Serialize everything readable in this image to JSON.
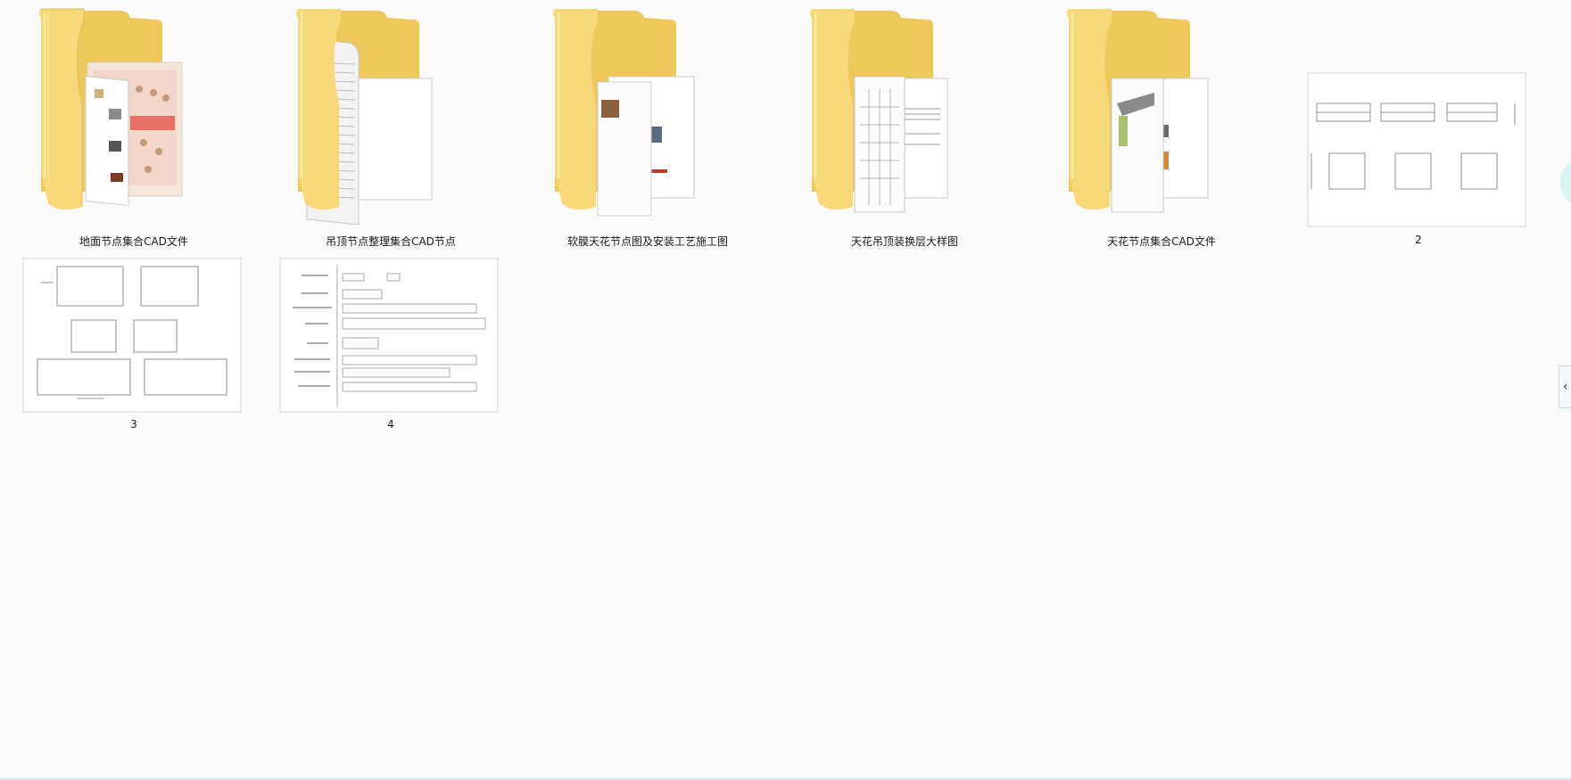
{
  "items": [
    {
      "name": "地面节点集合CAD文件",
      "type": "folder",
      "icon": "folder-icon"
    },
    {
      "name": "吊顶节点整理集合CAD节点",
      "type": "folder",
      "icon": "folder-icon"
    },
    {
      "name": "软膜天花节点图及安装工艺施工图",
      "type": "folder",
      "icon": "folder-icon"
    },
    {
      "name": "天花吊顶装换层大样图",
      "type": "folder",
      "icon": "folder-icon"
    },
    {
      "name": "天花节点集合CAD文件",
      "type": "folder",
      "icon": "folder-icon"
    },
    {
      "name": "2",
      "type": "image",
      "icon": "image-thumbnail"
    },
    {
      "name": "3",
      "type": "image",
      "icon": "image-thumbnail"
    },
    {
      "name": "4",
      "type": "image",
      "icon": "image-thumbnail"
    }
  ],
  "side_panel": {
    "expander_glyph": "‹",
    "icon": "chevron-left-icon"
  },
  "colors": {
    "background": "#fbfbfb",
    "folder_front": "#f7d97a",
    "folder_back": "#efc85c",
    "caption_text": "#1a1a1a"
  }
}
